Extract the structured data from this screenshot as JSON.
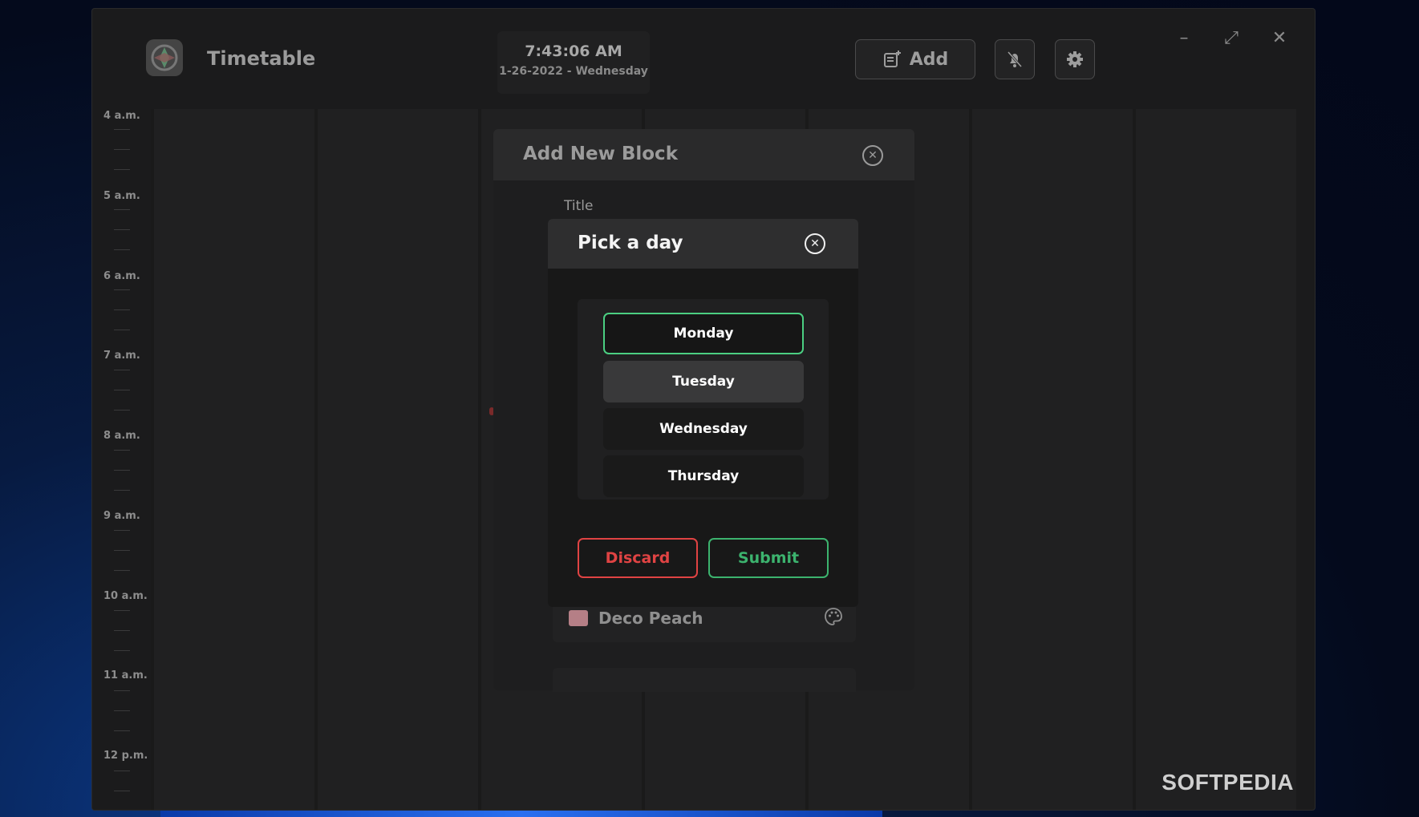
{
  "app": {
    "title": "Timetable",
    "clock_time": "7:43:06 AM",
    "clock_date": "1-26-2022 - Wednesday",
    "add_label": "Add"
  },
  "timeline": {
    "hours": [
      "4 a.m.",
      "5 a.m.",
      "6 a.m.",
      "7 a.m.",
      "8 a.m.",
      "9 a.m.",
      "10 a.m.",
      "11 a.m.",
      "12 p.m."
    ]
  },
  "add_block": {
    "title": "Add New Block",
    "title_field_label": "Title",
    "color_name": "Deco Peach",
    "color_hex": "#b57f86"
  },
  "pick_day": {
    "title": "Pick a day",
    "days": [
      "Monday",
      "Tuesday",
      "Wednesday",
      "Thursday"
    ],
    "selected": "Monday",
    "discard_label": "Discard",
    "submit_label": "Submit"
  },
  "watermark": "SOFTPEDIA",
  "colors": {
    "accent_green": "#4bcf82",
    "discard_red": "#e04343",
    "submit_green": "#3cb36e"
  }
}
